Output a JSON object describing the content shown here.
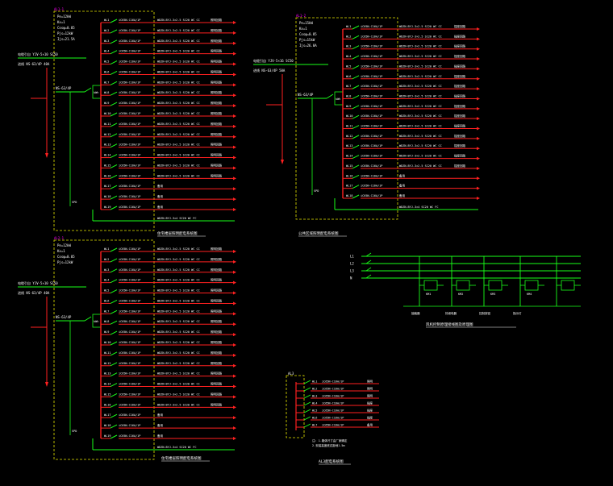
{
  "colors": {
    "background": "#000000",
    "busbar": "#ff2020",
    "branch": "#ff2020",
    "switch": "#19ff19",
    "frame": "#e6e600",
    "panel_tag": "#ff00ff",
    "text": "#ffffff"
  },
  "panels": [
    {
      "id": "p1",
      "tag": "AL1-1",
      "params": [
        "Pe=12kW",
        "Kx=1",
        "Cosφ=0.85",
        "Pjs=12kW",
        "Ijs=21.5A"
      ],
      "incoming": "电缆引自 YJV-5×10 SC50",
      "incoming2": "进线 NS-63/4P 40A",
      "main_breaker": "NS-63/4P",
      "meter": "kWh",
      "spd": "SPD",
      "branch_count": 19,
      "branch_breaker": "iC65N-C16A/1P",
      "branch_cable": "WDZN-BYJ-3×2.5 SC20 WC CC",
      "branch_load": "照明回路",
      "spare_label": "备用",
      "bottom_cable": "WDZN-BYJ-3×4 SC20 WC FC",
      "caption": "住宅楼层照明配电系统图"
    },
    {
      "id": "p2",
      "tag": "AL1-2",
      "params": [
        "Pe=15kW",
        "Kx=1",
        "Cosφ=0.85",
        "Pjs=15kW",
        "Ijs=26.8A"
      ],
      "incoming": "电缆引自 YJV-5×16 SC50",
      "incoming2": "进线 NS-63/4P 50A",
      "main_breaker": "NS-63/4P",
      "meter": "kWh",
      "spd": "SPD",
      "branch_count": 18,
      "branch_breaker": "iC65N-C16A/1P",
      "branch_cable": "WDZN-BYJ-3×2.5 SC20 WC CC",
      "branch_load": "插座回路",
      "spare_label": "备用",
      "bottom_cable": "WDZN-BYJ-3×4 SC20 WC FC",
      "caption": "公共区域照明配电系统图"
    },
    {
      "id": "p3",
      "tag": "AL2-1",
      "params": [
        "Pe=12kW",
        "Kx=1",
        "Cosφ=0.85",
        "Pjs=12kW"
      ],
      "incoming": "电缆引自 YJV-5×10 SC50",
      "incoming2": "进线 NS-63/4P 40A",
      "main_breaker": "NS-63/4P",
      "meter": "kWh",
      "spd": "SPD",
      "branch_count": 19,
      "branch_breaker": "iC65N-C16A/1P",
      "branch_cable": "WDZN-BYJ-3×2.5 SC20 WC CC",
      "branch_load": "照明回路",
      "spare_label": "备用",
      "bottom_cable": "WDZN-BYJ-3×4 SC20 WC FC",
      "caption": "住宅楼层照明配电系统图"
    }
  ],
  "control": {
    "phases": [
      "L1",
      "L2",
      "L3",
      "N"
    ],
    "labels": [
      "接触器",
      "热继电器",
      "控制按钮",
      "指示灯"
    ],
    "relays": [
      "KM1",
      "KM2",
      "KM3",
      "KM4"
    ],
    "caption": "风机控制原理接线图及原理图"
  },
  "small_panel": {
    "tag": "AL3",
    "rows": [
      "WL1",
      "WL2",
      "WL3",
      "WL4",
      "WL5",
      "WL6",
      "WL7"
    ],
    "breaker": "iC65N-C16A/1P",
    "loads": [
      "照明",
      "照明",
      "照明",
      "插座",
      "插座",
      "插座",
      "备用"
    ],
    "notes": [
      "注: 1.箱体尺寸由厂家确定",
      "2.安装高度底边距地1.5m"
    ],
    "caption": "AL3配电系统图"
  }
}
